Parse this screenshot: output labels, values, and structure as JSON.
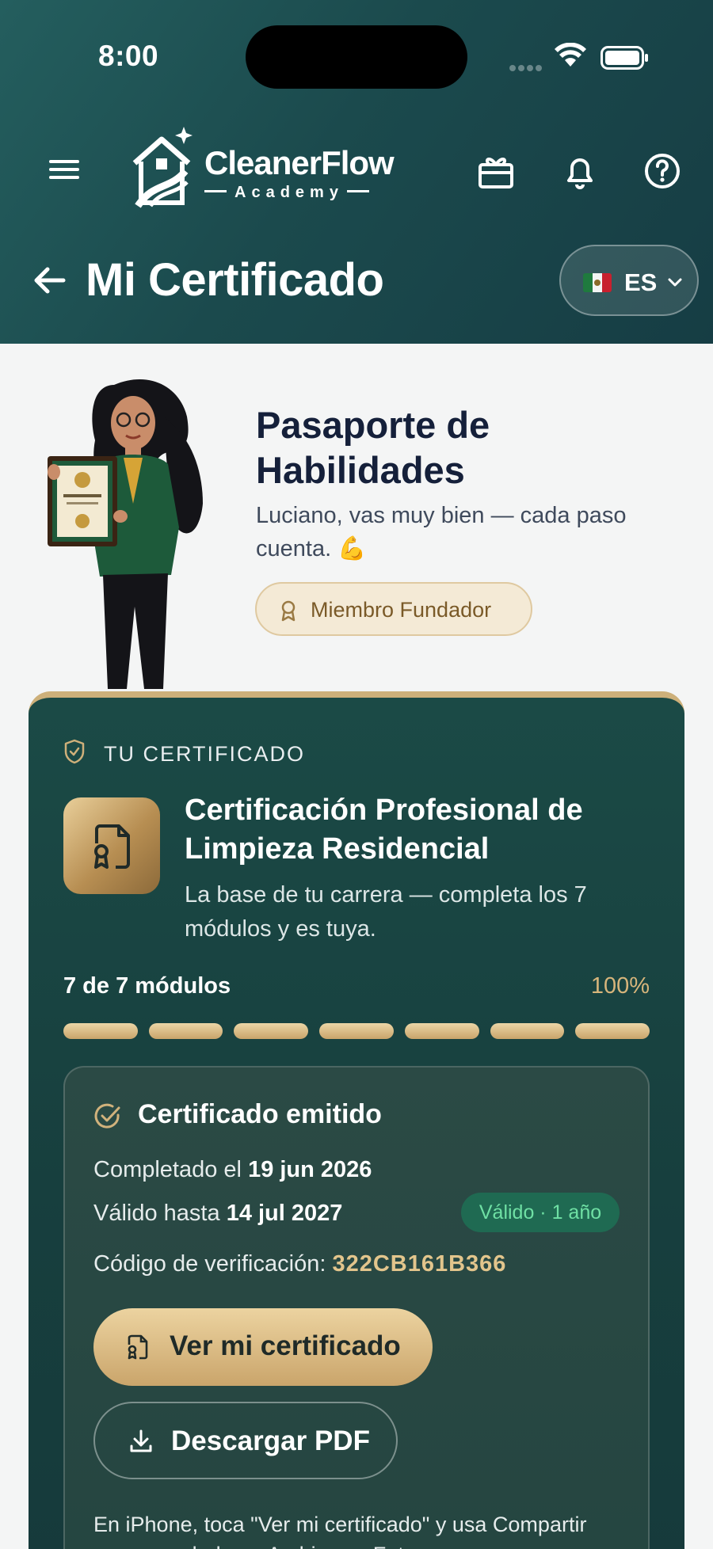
{
  "status_bar": {
    "time": "8:00"
  },
  "brand": {
    "name": "CleanerFlow",
    "sub": "Academy"
  },
  "header": {
    "title": "Mi Certificado",
    "language": "ES"
  },
  "hero": {
    "title": "Pasaporte de Habilidades",
    "subtitle": "Luciano, vas muy bien — cada paso cuenta. 💪",
    "badge": "Miembro Fundador"
  },
  "certificate": {
    "tag": "TU CERTIFICADO",
    "title": "Certificación Profesional de Limpieza Residencial",
    "description": "La base de tu carrera — completa los 7 módulos y es tuya.",
    "progress_label": "7 de 7 módulos",
    "progress_percent": "100%",
    "modules_completed": 7,
    "modules_total": 7,
    "issued": {
      "title": "Certificado emitido",
      "completed_label": "Completado el",
      "completed_date": "19 jun 2026",
      "valid_label": "Válido hasta",
      "valid_date": "14 jul 2027",
      "valid_badge": "Válido · 1 año",
      "code_label": "Código de verificación:",
      "code": "322CB161B366",
      "view_button": "Ver mi certificado",
      "pdf_button": "Descargar PDF",
      "hint": "En iPhone, toca \"Ver mi certificado\" y usa Compartir para guardarlo en Archivos o Fotos."
    }
  },
  "colors": {
    "header_bg": "#1b4a4d",
    "card_bg": "#173f3e",
    "gold": "#caa56b",
    "valid_green": "#6fe0a4"
  }
}
